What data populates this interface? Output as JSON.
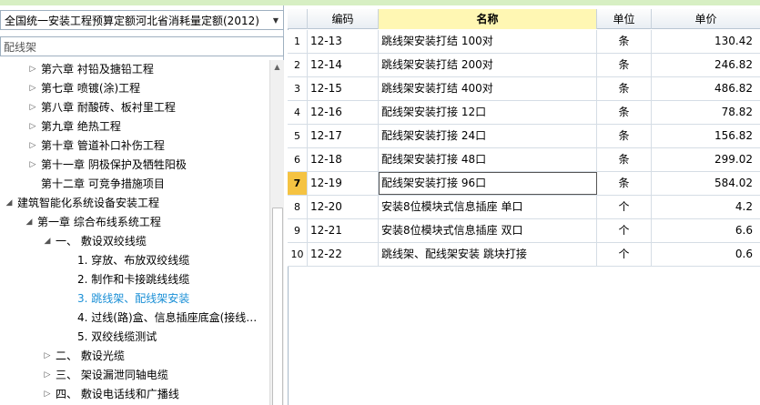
{
  "quota_selector": {
    "value": "全国统一安装工程预算定额河北省消耗量定额(2012)"
  },
  "search": {
    "value": "配线架"
  },
  "tree": [
    {
      "label": "第六章 衬铅及搪铅工程",
      "arrow": "▷",
      "indent": 30,
      "active": false
    },
    {
      "label": "第七章 喷镀(涂)工程",
      "arrow": "▷",
      "indent": 30,
      "active": false
    },
    {
      "label": "第八章 耐酸砖、板衬里工程",
      "arrow": "▷",
      "indent": 30,
      "active": false
    },
    {
      "label": "第九章 绝热工程",
      "arrow": "▷",
      "indent": 30,
      "active": false
    },
    {
      "label": "第十章 管道补口补伤工程",
      "arrow": "▷",
      "indent": 30,
      "active": false
    },
    {
      "label": "第十一章 阴极保护及牺牲阳极",
      "arrow": "▷",
      "indent": 30,
      "active": false
    },
    {
      "label": "第十二章 可竞争措施项目",
      "arrow": "",
      "indent": 30,
      "active": false
    },
    {
      "label": "建筑智能化系统设备安装工程",
      "arrow": "◢",
      "indent": 4,
      "active": false
    },
    {
      "label": "第一章 综合布线系统工程",
      "arrow": "◢",
      "indent": 26,
      "active": false
    },
    {
      "label": "一、 敷设双绞线缆",
      "arrow": "◢",
      "indent": 46,
      "active": false
    },
    {
      "label": "1. 穿放、布放双绞线缆",
      "arrow": "",
      "indent": 70,
      "active": false
    },
    {
      "label": "2. 制作和卡接跳线线缆",
      "arrow": "",
      "indent": 70,
      "active": false
    },
    {
      "label": "3. 跳线架、配线架安装",
      "arrow": "",
      "indent": 70,
      "active": true
    },
    {
      "label": "4. 过线(路)盒、信息插座底盒(接线…",
      "arrow": "",
      "indent": 70,
      "active": false
    },
    {
      "label": "5. 双绞线缆测试",
      "arrow": "",
      "indent": 70,
      "active": false
    },
    {
      "label": "二、 敷设光缆",
      "arrow": "▷",
      "indent": 46,
      "active": false
    },
    {
      "label": "三、 架设漏泄同轴电缆",
      "arrow": "▷",
      "indent": 46,
      "active": false
    },
    {
      "label": "四、 敷设电话线和广播线",
      "arrow": "▷",
      "indent": 46,
      "active": false
    }
  ],
  "grid": {
    "headers": {
      "code": "编码",
      "name": "名称",
      "unit": "单位",
      "price": "单价"
    },
    "rows": [
      {
        "idx": "1",
        "code": "12-13",
        "name": "跳线架安装打结 100对",
        "unit": "条",
        "price": "130.42"
      },
      {
        "idx": "2",
        "code": "12-14",
        "name": "跳线架安装打结 200对",
        "unit": "条",
        "price": "246.82"
      },
      {
        "idx": "3",
        "code": "12-15",
        "name": "跳线架安装打结 400对",
        "unit": "条",
        "price": "486.82"
      },
      {
        "idx": "4",
        "code": "12-16",
        "name": "配线架安装打接 12口",
        "unit": "条",
        "price": "78.82"
      },
      {
        "idx": "5",
        "code": "12-17",
        "name": "配线架安装打接 24口",
        "unit": "条",
        "price": "156.82"
      },
      {
        "idx": "6",
        "code": "12-18",
        "name": "配线架安装打接 48口",
        "unit": "条",
        "price": "299.02"
      },
      {
        "idx": "7",
        "code": "12-19",
        "name": "配线架安装打接 96口",
        "unit": "条",
        "price": "584.02",
        "selected": true
      },
      {
        "idx": "8",
        "code": "12-20",
        "name": "安装8位模块式信息插座 单口",
        "unit": "个",
        "price": "4.2"
      },
      {
        "idx": "9",
        "code": "12-21",
        "name": "安装8位模块式信息插座 双口",
        "unit": "个",
        "price": "6.6"
      },
      {
        "idx": "10",
        "code": "12-22",
        "name": "跳线架、配线架安装 跳块打接",
        "unit": "个",
        "price": "0.6"
      }
    ]
  }
}
